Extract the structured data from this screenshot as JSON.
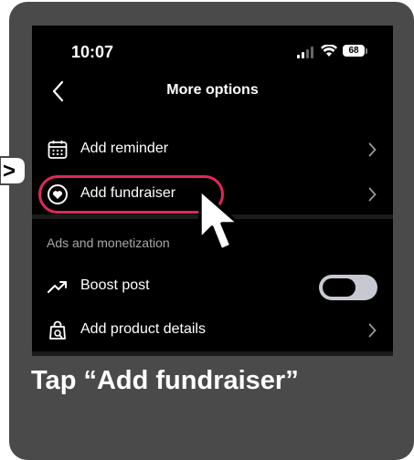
{
  "status_bar": {
    "time": "10:07",
    "battery": "68"
  },
  "nav": {
    "title": "More options",
    "back_icon": "chevron-left-icon"
  },
  "menu": {
    "reminder_label": "Add reminder",
    "fundraiser_label": "Add fundraiser",
    "section_ads": "Ads and monetization",
    "boost_label": "Boost post",
    "boost_toggle_on": false,
    "product_label": "Add product details"
  },
  "instruction": {
    "caption": "Tap “Add fundraiser”",
    "pointer_glyph": ">"
  },
  "colors": {
    "highlight": "#e0285a",
    "card": "#4a4a4a",
    "screen": "#000000"
  }
}
